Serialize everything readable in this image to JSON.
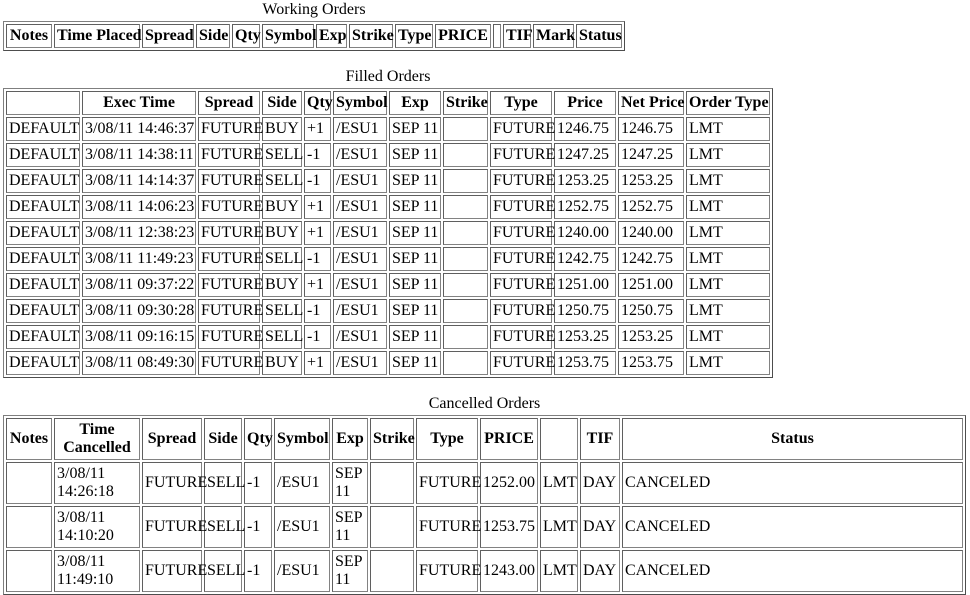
{
  "working": {
    "title": "Working Orders",
    "headers": [
      "Notes",
      "Time Placed",
      "Spread",
      "Side",
      "Qty",
      "Symbol",
      "Exp",
      "Strike",
      "Type",
      "PRICE",
      "",
      "TIF",
      "Mark",
      "Status"
    ],
    "rows": []
  },
  "filled": {
    "title": "Filled Orders",
    "headers": [
      "",
      "Exec Time",
      "Spread",
      "Side",
      "Qty",
      "Symbol",
      "Exp",
      "Strike",
      "Type",
      "Price",
      "Net Price",
      "Order Type"
    ],
    "rows": [
      [
        "DEFAULT",
        "3/08/11 14:46:37",
        "FUTURE",
        "BUY",
        "+1",
        "/ESU1",
        "SEP 11",
        "",
        "FUTURE",
        "1246.75",
        "1246.75",
        "LMT"
      ],
      [
        "DEFAULT",
        "3/08/11 14:38:11",
        "FUTURE",
        "SELL",
        "-1",
        "/ESU1",
        "SEP 11",
        "",
        "FUTURE",
        "1247.25",
        "1247.25",
        "LMT"
      ],
      [
        "DEFAULT",
        "3/08/11 14:14:37",
        "FUTURE",
        "SELL",
        "-1",
        "/ESU1",
        "SEP 11",
        "",
        "FUTURE",
        "1253.25",
        "1253.25",
        "LMT"
      ],
      [
        "DEFAULT",
        "3/08/11 14:06:23",
        "FUTURE",
        "BUY",
        "+1",
        "/ESU1",
        "SEP 11",
        "",
        "FUTURE",
        "1252.75",
        "1252.75",
        "LMT"
      ],
      [
        "DEFAULT",
        "3/08/11 12:38:23",
        "FUTURE",
        "BUY",
        "+1",
        "/ESU1",
        "SEP 11",
        "",
        "FUTURE",
        "1240.00",
        "1240.00",
        "LMT"
      ],
      [
        "DEFAULT",
        "3/08/11 11:49:23",
        "FUTURE",
        "SELL",
        "-1",
        "/ESU1",
        "SEP 11",
        "",
        "FUTURE",
        "1242.75",
        "1242.75",
        "LMT"
      ],
      [
        "DEFAULT",
        "3/08/11 09:37:22",
        "FUTURE",
        "BUY",
        "+1",
        "/ESU1",
        "SEP 11",
        "",
        "FUTURE",
        "1251.00",
        "1251.00",
        "LMT"
      ],
      [
        "DEFAULT",
        "3/08/11 09:30:28",
        "FUTURE",
        "SELL",
        "-1",
        "/ESU1",
        "SEP 11",
        "",
        "FUTURE",
        "1250.75",
        "1250.75",
        "LMT"
      ],
      [
        "DEFAULT",
        "3/08/11 09:16:15",
        "FUTURE",
        "SELL",
        "-1",
        "/ESU1",
        "SEP 11",
        "",
        "FUTURE",
        "1253.25",
        "1253.25",
        "LMT"
      ],
      [
        "DEFAULT",
        "3/08/11 08:49:30",
        "FUTURE",
        "BUY",
        "+1",
        "/ESU1",
        "SEP 11",
        "",
        "FUTURE",
        "1253.75",
        "1253.75",
        "LMT"
      ]
    ]
  },
  "cancelled": {
    "title": "Cancelled Orders",
    "headers": [
      "Notes",
      "Time Cancelled",
      "Spread",
      "Side",
      "Qty",
      "Symbol",
      "Exp",
      "Strike",
      "Type",
      "PRICE",
      "",
      "TIF",
      "Status"
    ],
    "rows": [
      [
        "",
        "3/08/11 14:26:18",
        "FUTURE",
        "SELL",
        "-1",
        "/ESU1",
        "SEP 11",
        "",
        "FUTURE",
        "1252.00",
        "LMT",
        "DAY",
        "CANCELED"
      ],
      [
        "",
        "3/08/11 14:10:20",
        "FUTURE",
        "SELL",
        "-1",
        "/ESU1",
        "SEP 11",
        "",
        "FUTURE",
        "1253.75",
        "LMT",
        "DAY",
        "CANCELED"
      ],
      [
        "",
        "3/08/11 11:49:10",
        "FUTURE",
        "SELL",
        "-1",
        "/ESU1",
        "SEP 11",
        "",
        "FUTURE",
        "1243.00",
        "LMT",
        "DAY",
        "CANCELED"
      ]
    ]
  }
}
